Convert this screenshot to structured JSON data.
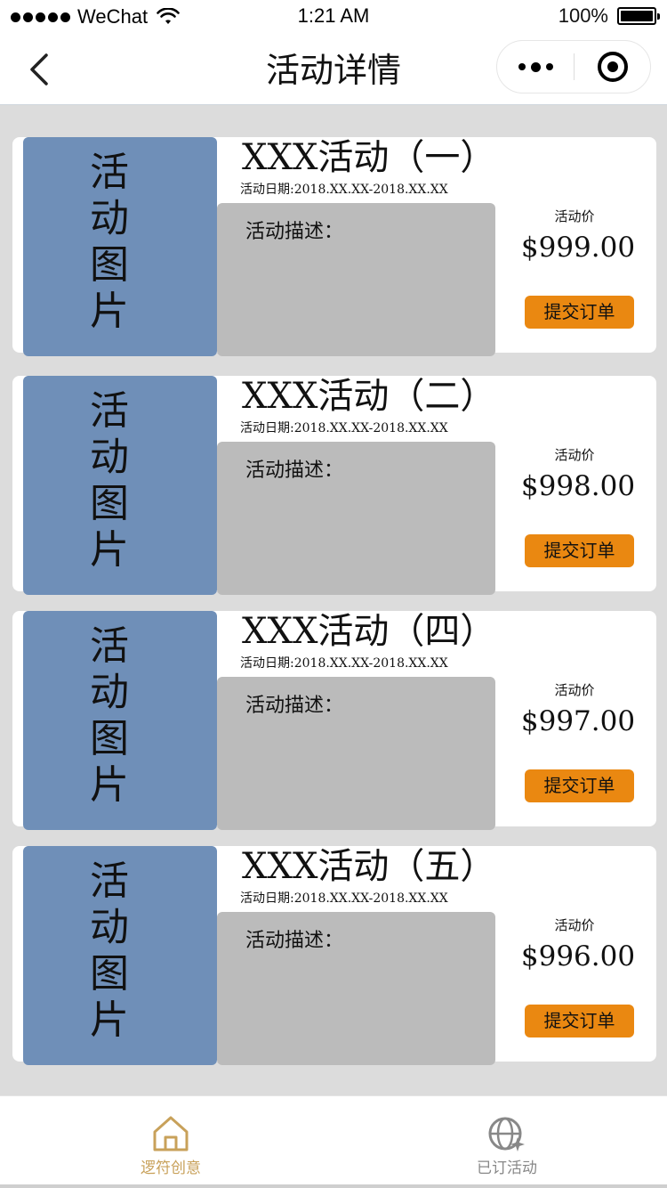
{
  "status_bar": {
    "carrier": "WeChat",
    "time": "1:21 AM",
    "battery": "100%"
  },
  "nav": {
    "title": "活动详情"
  },
  "activities": [
    {
      "title": "XXX活动（一）",
      "image_text": "活动图片",
      "date": "活动日期:2018.XX.XX-2018.XX.XX",
      "desc_label": "活动描述：",
      "price_label": "活动价",
      "price": "$999.00",
      "button": "提交订单"
    },
    {
      "title": "XXX活动（二）",
      "image_text": "活动图片",
      "date": "活动日期:2018.XX.XX-2018.XX.XX",
      "desc_label": "活动描述：",
      "price_label": "活动价",
      "price": "$998.00",
      "button": "提交订单"
    },
    {
      "title": "XXX活动（四）",
      "image_text": "活动图片",
      "date": "活动日期:2018.XX.XX-2018.XX.XX",
      "desc_label": "活动描述：",
      "price_label": "活动价",
      "price": "$997.00",
      "button": "提交订单"
    },
    {
      "title": "XXX活动（五）",
      "image_text": "活动图片",
      "date": "活动日期:2018.XX.XX-2018.XX.XX",
      "desc_label": "活动描述：",
      "price_label": "活动价",
      "price": "$996.00",
      "button": "提交订单"
    }
  ],
  "tabs": [
    {
      "label": "逻符创意",
      "icon": "home-icon",
      "active": true
    },
    {
      "label": "已订活动",
      "icon": "globe-icon",
      "active": false
    }
  ],
  "colors": {
    "image_placeholder": "#6f8fb8",
    "desc_box": "#bbbbbb",
    "order_button": "#ea8811",
    "tab_active": "#c8a15a",
    "tab_inactive": "#888888",
    "page_bg": "#dcdcdc"
  }
}
